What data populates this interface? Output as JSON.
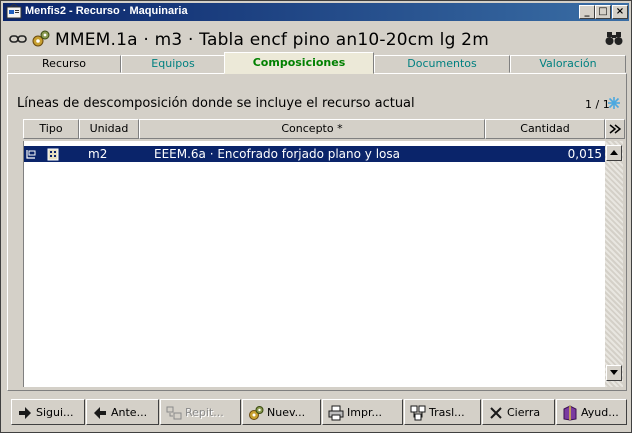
{
  "window": {
    "title": "Menfis2 - Recurso · Maquinaria",
    "min_label": "_",
    "max_label": "□",
    "close_label": "×"
  },
  "header": {
    "resource_title": "MMEM.1a · m3 · Tabla encf  pino an10-20cm lg 2m"
  },
  "tabs": [
    {
      "label": "Recurso",
      "active": false
    },
    {
      "label": "Equipos",
      "active": false
    },
    {
      "label": "Composiciones",
      "active": true
    },
    {
      "label": "Documentos",
      "active": false
    },
    {
      "label": "Valoración",
      "active": false
    }
  ],
  "panel": {
    "description": "Líneas de descomposición donde se incluye el recurso actual",
    "page_count": "1 / 1"
  },
  "grid": {
    "columns": [
      "Tipo",
      "Unidad",
      "Concepto *",
      "Cantidad"
    ],
    "rows": [
      {
        "unidad": "m2",
        "concepto": "EEEM.6a · Encofrado forjado plano y losa",
        "cantidad": "0,015",
        "selected": true
      }
    ]
  },
  "toolbar": {
    "buttons": [
      {
        "label": "Sigui...",
        "icon": "arrow-right-icon",
        "enabled": true
      },
      {
        "label": "Ante...",
        "icon": "arrow-left-icon",
        "enabled": true
      },
      {
        "label": "Repit...",
        "icon": "repeat-icon",
        "enabled": false
      },
      {
        "label": "Nuev...",
        "icon": "gears-icon",
        "enabled": true
      },
      {
        "label": "Impr...",
        "icon": "printer-icon",
        "enabled": true
      },
      {
        "label": "Trasl...",
        "icon": "transfer-icon",
        "enabled": true
      },
      {
        "label": "Cierra",
        "icon": "close-icon",
        "enabled": true
      },
      {
        "label": "Ayud...",
        "icon": "help-book-icon",
        "enabled": true
      }
    ]
  },
  "colors": {
    "titlebar": "#0a246a",
    "active_tab_text": "#008000",
    "inactive_tab_text": "#008080",
    "selection": "#0a246a",
    "face": "#d4d0c8"
  }
}
